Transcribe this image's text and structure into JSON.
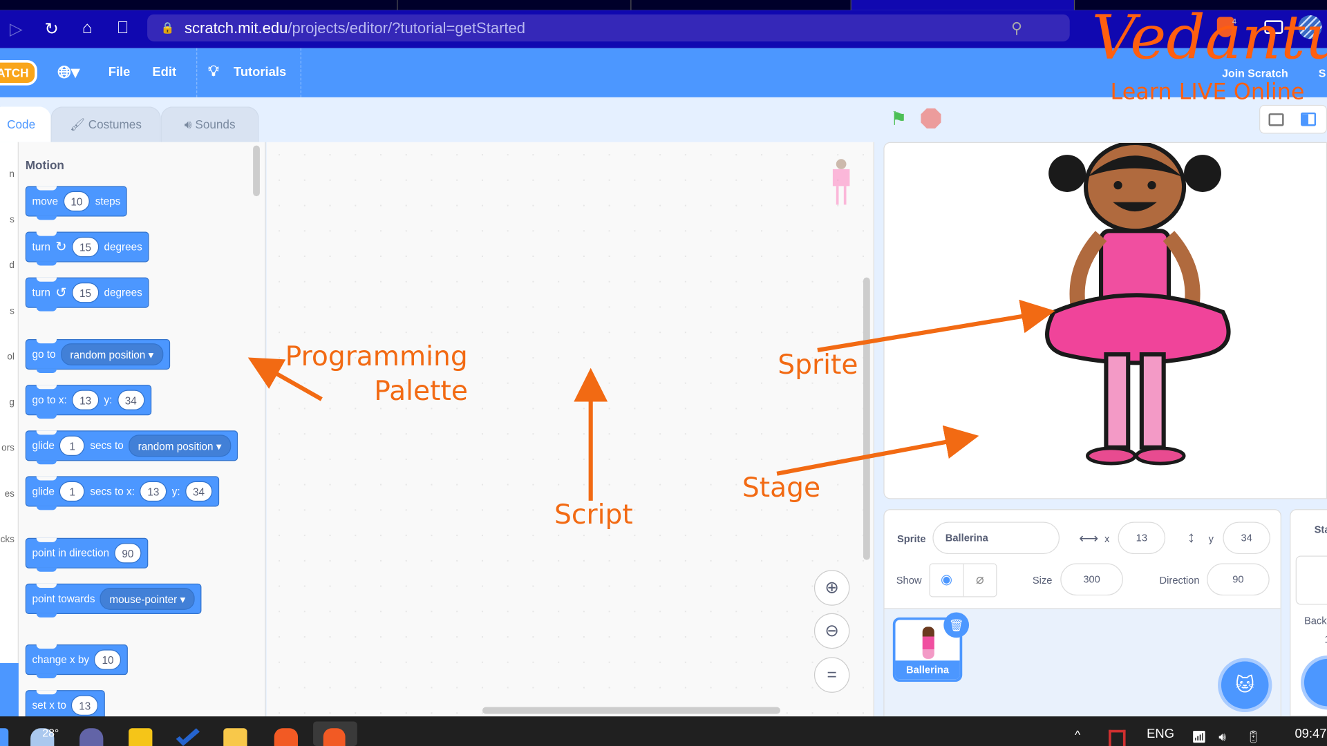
{
  "browser": {
    "url_host": "scratch.mit.edu",
    "url_path": "/projects/editor/?tutorial=getStarted",
    "extension_badge": "4"
  },
  "menu": {
    "logo": "ATCH",
    "file": "File",
    "edit": "Edit",
    "tutorials": "Tutorials",
    "join": "Join Scratch",
    "signin": "S"
  },
  "watermark": {
    "brand": "Vedantu",
    "tagline": "Learn LIVE Online"
  },
  "tabs": {
    "code": "Code",
    "costumes": "Costumes",
    "sounds": "Sounds"
  },
  "categories": [
    "n",
    "s",
    "d",
    "s",
    "ol",
    "g",
    "ors",
    "es",
    "cks"
  ],
  "palette": {
    "heading": "Motion",
    "blocks": [
      {
        "parts": [
          "move",
          "[10]",
          "steps"
        ]
      },
      {
        "parts": [
          "turn",
          "↻",
          "[15]",
          "degrees"
        ]
      },
      {
        "parts": [
          "turn",
          "↺",
          "[15]",
          "degrees"
        ]
      },
      {
        "parts": [
          "go to",
          "{random position}"
        ]
      },
      {
        "parts": [
          "go to x:",
          "[13]",
          "y:",
          "[34]"
        ]
      },
      {
        "parts": [
          "glide",
          "[1]",
          "secs to",
          "{random position}"
        ]
      },
      {
        "parts": [
          "glide",
          "[1]",
          "secs to x:",
          "[13]",
          "y:",
          "[34]"
        ]
      },
      {
        "parts": [
          "point in direction",
          "[90]"
        ]
      },
      {
        "parts": [
          "point towards",
          "{mouse-pointer}"
        ]
      },
      {
        "parts": [
          "change x by",
          "[10]"
        ]
      },
      {
        "parts": [
          "set x to",
          "[13]"
        ]
      }
    ]
  },
  "annotations": {
    "palette_line1": "Programming",
    "palette_line2": "Palette",
    "script": "Script",
    "sprite": "Sprite",
    "stage": "Stage"
  },
  "sprite_info": {
    "sprite_label": "Sprite",
    "sprite_name": "Ballerina",
    "x_label": "x",
    "x": "13",
    "y_label": "y",
    "y": "34",
    "show_label": "Show",
    "size_label": "Size",
    "size": "300",
    "direction_label": "Direction",
    "direction": "90",
    "visible": true
  },
  "sprite_list": [
    {
      "name": "Ballerina",
      "selected": true
    }
  ],
  "stage_panel": {
    "title": "Sta",
    "backdrops_label": "Back",
    "backdrop_count": "1"
  },
  "taskbar": {
    "weather": "28°",
    "language": "ENG",
    "time": "09:47"
  },
  "colors": {
    "scratch_blue": "#4c97ff",
    "annotation": "#f26a13",
    "browser_bar": "#1008b0",
    "flag": "#4cbf56",
    "stop": "#ec9c9c"
  }
}
